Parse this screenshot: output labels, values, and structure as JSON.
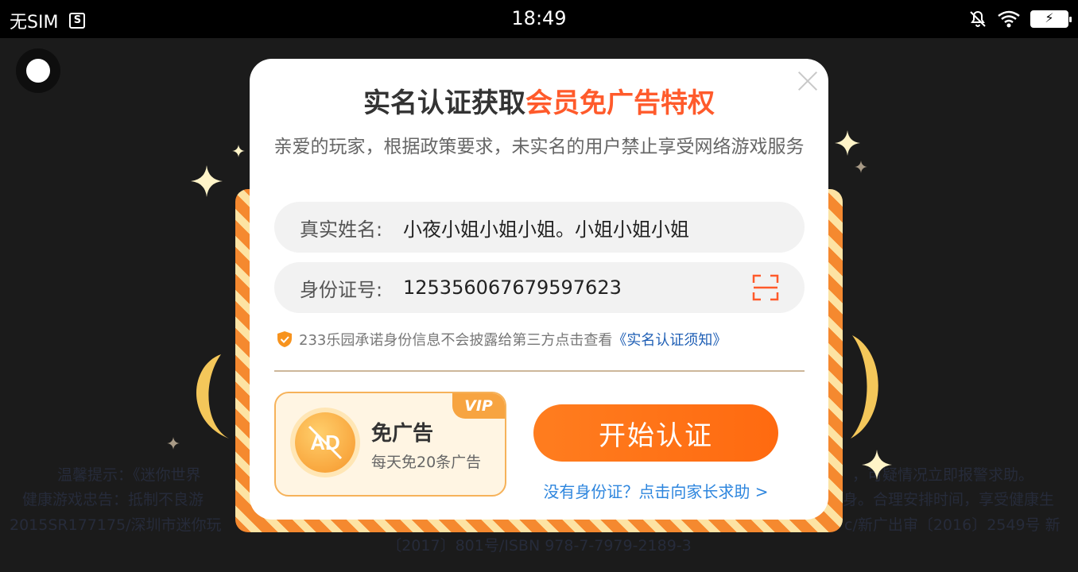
{
  "status_bar": {
    "carrier": "无SIM",
    "sim_icon": "S",
    "time": "18:49",
    "battery_icon": "⚡"
  },
  "background": {
    "line1_left": "温馨提示：《迷你世界",
    "line1_right": "，可疑情况立即报警求助。",
    "line2_left": "健康游戏忠告：抵制不良游",
    "line2_right": "身。合理安排时间，享受健康生",
    "line3_left": "2015SR177175/深圳市迷你玩",
    "line3_right": "c/新广出审〔2016〕2549号 新",
    "line4": "〔2017〕801号/ISBN 978-7-7979-2189-3"
  },
  "modal": {
    "title_prefix": "实名认证获取",
    "title_highlight": "会员免广告特权",
    "description": "亲爱的玩家，根据政策要求，未实名的用户禁止享受网络游戏服务",
    "name_label": "真实姓名:",
    "name_value": "小夜小姐小姐小姐。小姐小姐小姐",
    "id_label": "身份证号:",
    "id_value": "125356067679597623",
    "notice_text": "233乐园承诺身份信息不会披露给第三方点击查看",
    "notice_link": "《实名认证须知》",
    "vip_badge": "VIP",
    "ad_icon_text": "AD",
    "vip_title": "免广告",
    "vip_subtitle": "每天免20条广告",
    "start_button": "开始认证",
    "parent_link": "没有身份证？点击向家长求助 >"
  },
  "colors": {
    "accent_orange": "#ff6a10",
    "title_highlight": "#ff5a2b",
    "link_blue": "#2e86de"
  }
}
